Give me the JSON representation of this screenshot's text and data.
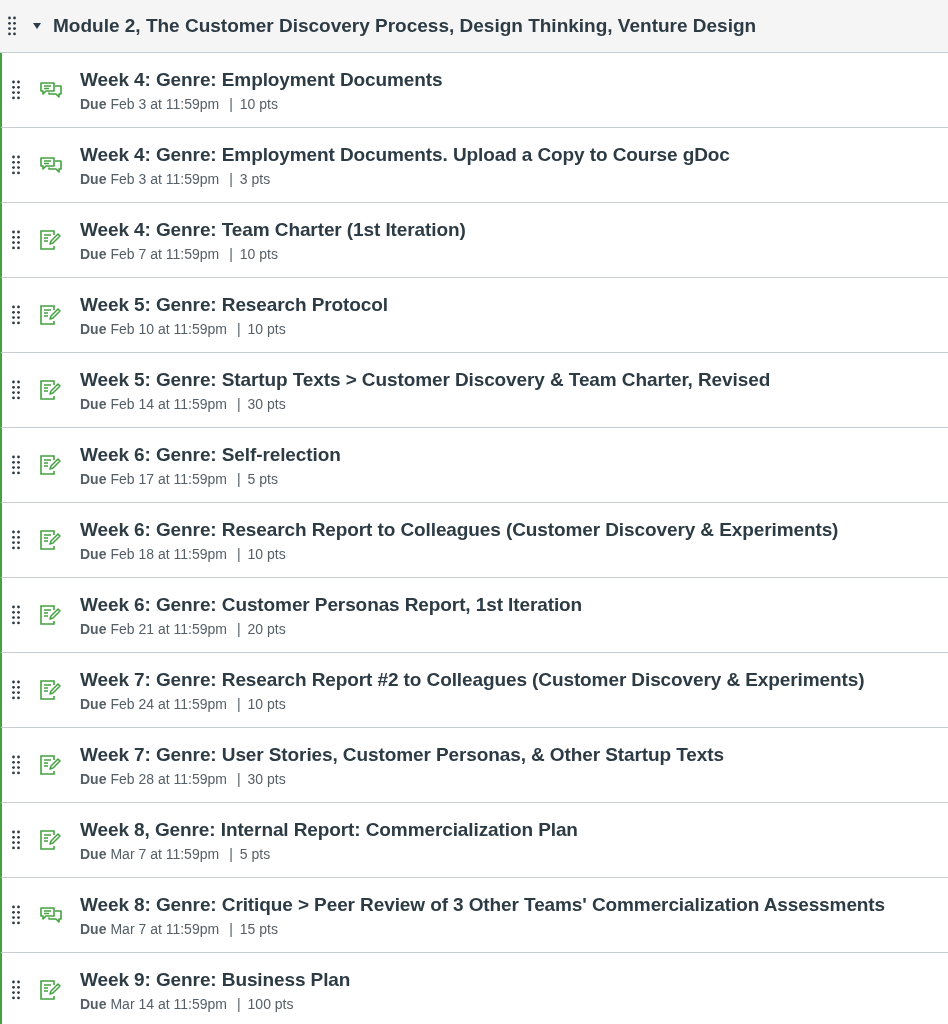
{
  "module": {
    "title": "Module 2, The Customer Discovery Process, Design Thinking, Venture Design",
    "expanded": true
  },
  "items": [
    {
      "kind": "discussion",
      "title": "Week 4: Genre: Employment Documents",
      "due_label": "Due",
      "due": "Feb 3 at 11:59pm",
      "separator": "|",
      "points": "10 pts"
    },
    {
      "kind": "discussion",
      "title": "Week 4: Genre: Employment Documents. Upload a Copy to Course gDoc",
      "due_label": "Due",
      "due": "Feb 3 at 11:59pm",
      "separator": "|",
      "points": "3 pts"
    },
    {
      "kind": "assignment",
      "title": "Week 4: Genre: Team Charter (1st Iteration)",
      "due_label": "Due",
      "due": "Feb 7 at 11:59pm",
      "separator": "|",
      "points": "10 pts"
    },
    {
      "kind": "assignment",
      "title": "Week 5: Genre: Research Protocol",
      "due_label": "Due",
      "due": "Feb 10 at 11:59pm",
      "separator": "|",
      "points": "10 pts"
    },
    {
      "kind": "assignment",
      "title": "Week 5: Genre: Startup Texts > Customer Discovery & Team Charter, Revised",
      "due_label": "Due",
      "due": "Feb 14 at 11:59pm",
      "separator": "|",
      "points": "30 pts"
    },
    {
      "kind": "assignment",
      "title": "Week 6: Genre: Self-relection",
      "due_label": "Due",
      "due": "Feb 17 at 11:59pm",
      "separator": "|",
      "points": "5 pts"
    },
    {
      "kind": "assignment",
      "title": "Week 6: Genre: Research Report to Colleagues (Customer Discovery & Experiments)",
      "due_label": "Due",
      "due": "Feb 18 at 11:59pm",
      "separator": "|",
      "points": "10 pts"
    },
    {
      "kind": "assignment",
      "title": "Week 6: Genre: Customer Personas Report, 1st Iteration",
      "due_label": "Due",
      "due": "Feb 21 at 11:59pm",
      "separator": "|",
      "points": "20 pts"
    },
    {
      "kind": "assignment",
      "title": "Week 7: Genre: Research Report #2 to Colleagues (Customer Discovery & Experiments)",
      "due_label": "Due",
      "due": "Feb 24 at 11:59pm",
      "separator": "|",
      "points": "10 pts"
    },
    {
      "kind": "assignment",
      "title": "Week 7: Genre: User Stories, Customer Personas, & Other Startup Texts",
      "due_label": "Due",
      "due": "Feb 28 at 11:59pm",
      "separator": "|",
      "points": "30 pts"
    },
    {
      "kind": "assignment",
      "title": "Week 8, Genre: Internal Report: Commercialization Plan",
      "due_label": "Due",
      "due": "Mar 7 at 11:59pm",
      "separator": "|",
      "points": "5 pts"
    },
    {
      "kind": "discussion",
      "title": "Week 8: Genre: Critique > Peer Review of 3 Other Teams' Commercialization Assessments",
      "due_label": "Due",
      "due": "Mar 7 at 11:59pm",
      "separator": "|",
      "points": "15 pts"
    },
    {
      "kind": "assignment",
      "title": "Week 9: Genre: Business Plan",
      "due_label": "Due",
      "due": "Mar 14 at 11:59pm",
      "separator": "|",
      "points": "100 pts"
    }
  ]
}
